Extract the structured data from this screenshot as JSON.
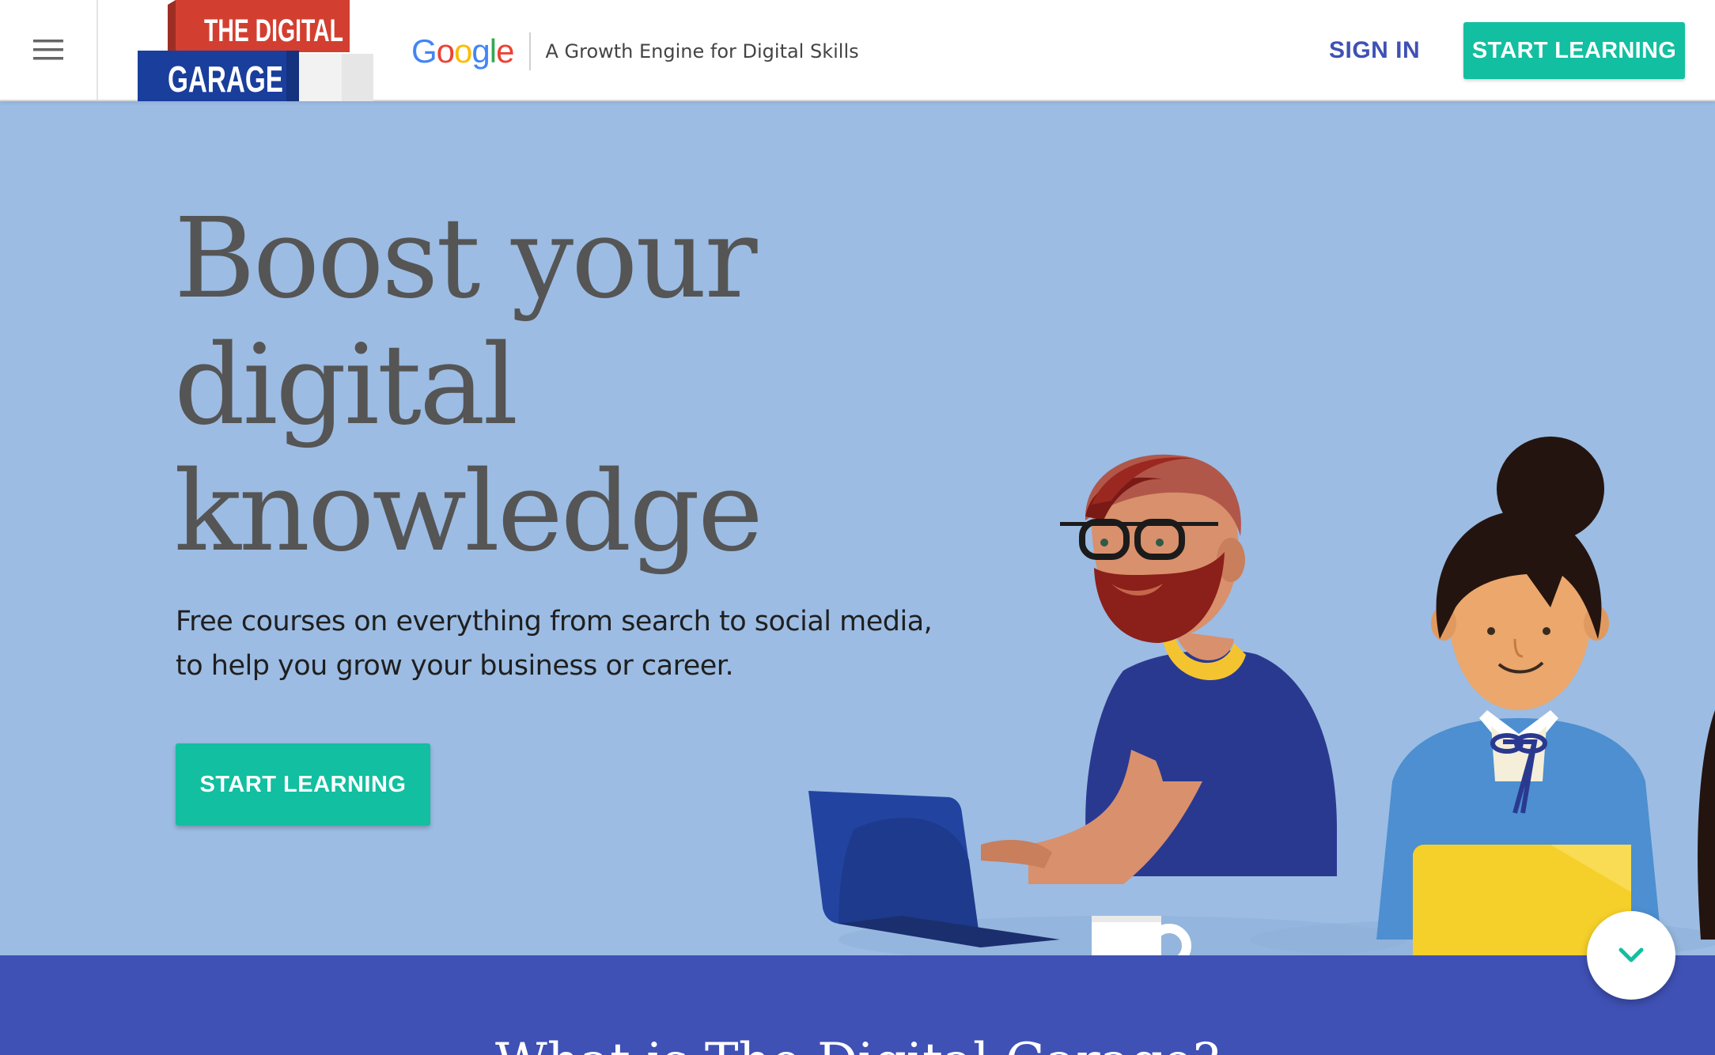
{
  "header": {
    "menu_icon": "hamburger-menu-icon",
    "logo": {
      "line1": "THE DIGITAL",
      "line2": "GARAGE",
      "colors": {
        "red": "#d23f31",
        "blue": "#1a3e9c"
      }
    },
    "google": {
      "wordmark": "Google",
      "letter_colors": [
        "#4285F4",
        "#EA4335",
        "#FBBC05",
        "#4285F4",
        "#34A853",
        "#EA4335"
      ]
    },
    "tagline": "A Growth Engine for Digital Skills",
    "sign_in_label": "SIGN IN",
    "cta_label": "START LEARNING"
  },
  "hero": {
    "headline_lines": [
      "Boost your",
      "digital",
      "knowledge"
    ],
    "subtext_line1": "Free courses on everything from search to social media,",
    "subtext_line2": "to help you grow your business or career.",
    "cta_label": "START LEARNING",
    "background": "#9cbce3"
  },
  "band": {
    "title": "What is The Digital Garage?",
    "background": "#3f51b5"
  },
  "scroll_button": {
    "icon": "chevron-down-icon",
    "color": "#12bfa0"
  },
  "colors": {
    "accent": "#12bfa0",
    "brand_blue": "#3f51b5"
  }
}
